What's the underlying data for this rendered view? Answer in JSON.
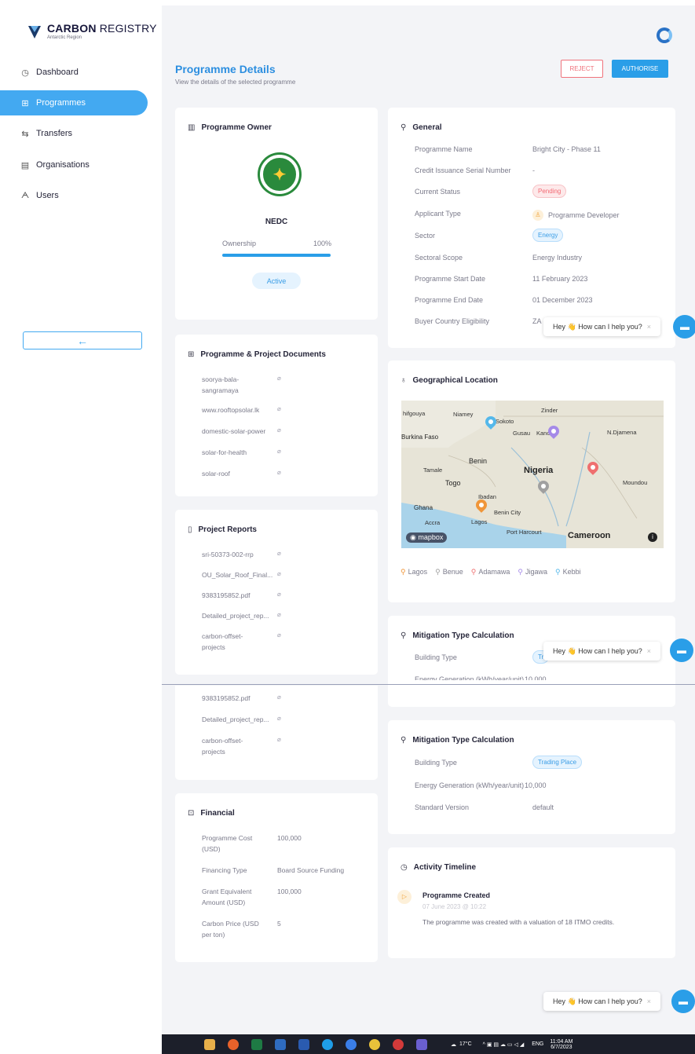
{
  "app": {
    "logo_bold": "CARBON",
    "logo_rest": " REGISTRY",
    "logo_sub": "Antarctic Region"
  },
  "sidebar": {
    "items": [
      {
        "label": "Dashboard",
        "icon": "gauge-icon"
      },
      {
        "label": "Programmes",
        "icon": "grid-icon"
      },
      {
        "label": "Transfers",
        "icon": "transfer-icon"
      },
      {
        "label": "Organisations",
        "icon": "building-icon"
      },
      {
        "label": "Users",
        "icon": "user-icon"
      }
    ],
    "collapse_label": "←"
  },
  "header": {
    "title": "Programme Details",
    "subtitle": "View the details of the selected programme",
    "reject_label": "REJECT",
    "authorise_label": "AUTHORISE"
  },
  "owner_card": {
    "title": "Programme Owner",
    "org_name": "NEDC",
    "ownership_label": "Ownership",
    "ownership_value": "100%",
    "ownership_fraction": 1.0,
    "status": "Active"
  },
  "documents_card": {
    "title": "Programme & Project Documents",
    "items": [
      "soorya-bala-",
      "sangramaya",
      "www.rooftopsolar.lk",
      "domestic-solar-power",
      "solar-for-health",
      "solar-roof"
    ]
  },
  "reports_card": {
    "title": "Project Reports",
    "items": [
      "sri-50373-002-rrp",
      "OU_Solar_Roof_Final...",
      "9383195852.pdf",
      "Detailed_project_rep...",
      "carbon-offset-",
      "projects"
    ]
  },
  "reports_repeat": {
    "items": [
      "9383195852.pdf",
      "Detailed_project_rep...",
      "carbon-offset-",
      "projects"
    ]
  },
  "financial_card": {
    "title": "Financial",
    "rows": [
      {
        "label": "Programme Cost",
        "label2": "(USD)",
        "value": "100,000"
      },
      {
        "label": "Financing Type",
        "label2": "",
        "value": "Board Source Funding"
      },
      {
        "label": "Grant Equivalent",
        "label2": "Amount (USD)",
        "value": "100,000"
      },
      {
        "label": "Carbon Price (USD",
        "label2": "per ton)",
        "value": "5"
      }
    ]
  },
  "general_card": {
    "title": "General",
    "rows": [
      {
        "label": "Programme Name",
        "value": "Bright City - Phase 11"
      },
      {
        "label": "Credit Issuance Serial Number",
        "value": "-"
      },
      {
        "label": "Current Status",
        "value": "Pending"
      },
      {
        "label": "Applicant Type",
        "value": "Programme Developer"
      },
      {
        "label": "Sector",
        "value": "Energy"
      },
      {
        "label": "Sectoral Scope",
        "value": "Energy Industry"
      },
      {
        "label": "Programme Start Date",
        "value": "11 February 2023"
      },
      {
        "label": "Programme End Date",
        "value": "01 December 2023"
      },
      {
        "label": "Buyer Country Eligibility",
        "value": "ZA"
      }
    ]
  },
  "geo_card": {
    "title": "Geographical Location",
    "map_labels": [
      "Niamey",
      "Zinder",
      "Sokoto",
      "Gusau",
      "Kano",
      "N.Djamena",
      "Burkina Faso",
      "Benin",
      "Nigeria",
      "Tamale",
      "Togo",
      "Moundou",
      "Ghana",
      "Ibadan",
      "Benin City",
      "Accra",
      "Lagos",
      "Port Harcourt",
      "Cameroon",
      "hifgouya"
    ],
    "attribution": "mapbox",
    "legend": [
      {
        "name": "Lagos",
        "color": "#f0963a"
      },
      {
        "name": "Benue",
        "color": "#a0a0a0"
      },
      {
        "name": "Adamawa",
        "color": "#ef6f6f"
      },
      {
        "name": "Jigawa",
        "color": "#a58ae8"
      },
      {
        "name": "Kebbi",
        "color": "#55b8ea"
      }
    ]
  },
  "mitigation_partial": {
    "title": "Mitigation Type Calculation",
    "rows": [
      {
        "label": "Building Type",
        "value": "Tr"
      },
      {
        "label": "Energy Generation (kWh/year/unit)",
        "value": "10,000"
      }
    ]
  },
  "mitigation_card": {
    "title": "Mitigation Type Calculation",
    "rows": [
      {
        "label": "Building Type",
        "value": "Trading Place"
      },
      {
        "label": "Energy Generation (kWh/year/unit)",
        "value": "10,000"
      },
      {
        "label": "Standard Version",
        "value": "default"
      }
    ]
  },
  "activity_card": {
    "title": "Activity Timeline",
    "event_title": "Programme Created",
    "event_time": "07 June 2023 @ 10:22",
    "event_desc": "The programme was created with a valuation of 18 ITMO credits."
  },
  "chat": {
    "prompt": "Hey 👋 How can I help you?",
    "close": "×"
  },
  "taskbar": {
    "weather": "17°C",
    "lang": "ENG",
    "time": "11:04 AM",
    "date": "6/7/2023"
  },
  "colors": {
    "accent": "#2a9ee8",
    "danger": "#f0737c"
  }
}
